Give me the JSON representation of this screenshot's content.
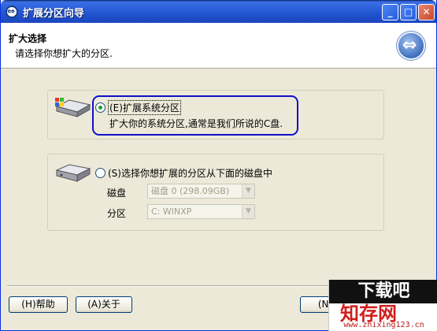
{
  "window": {
    "title": "扩展分区向导",
    "buttons": {
      "minimize": "_",
      "maximize": "□",
      "close": "✕"
    }
  },
  "header": {
    "title": "扩大选择",
    "subtitle": "请选择你想扩大的分区."
  },
  "options": {
    "system": {
      "label": "(E)扩展系统分区",
      "description": "扩大你的系统分区,通常是我们所说的C盘.",
      "checked": true
    },
    "other": {
      "label": "(S)选择你想扩展的分区从下面的磁盘中",
      "checked": false,
      "disk_label": "磁盘",
      "disk_value": "磁盘 0 (298.09GB)",
      "partition_label": "分区",
      "partition_value": "C: WINXP"
    }
  },
  "footer": {
    "help_label": "(H)帮助",
    "about_label": "(A)关于",
    "next_label": "(N)下"
  },
  "watermark": {
    "top": "下载吧",
    "middle": "知存网",
    "bottom": "www.zhixing123.cn"
  },
  "colors": {
    "titlebar": "#2a5cd8",
    "highlight_border": "#1010c8",
    "radio_checked": "#21a121",
    "window_bg": "#ece9d8"
  }
}
